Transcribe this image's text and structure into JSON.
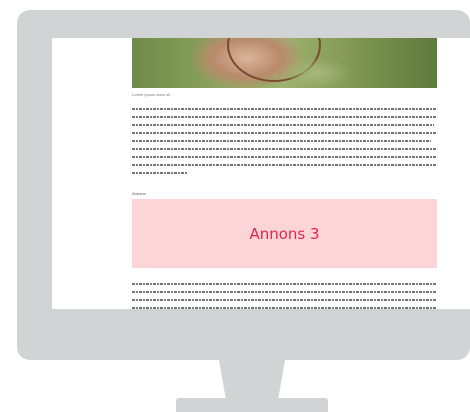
{
  "article": {
    "hero_image": "man-with-rope-in-grass-photo",
    "caption": "Lorem ipsum dolor sit",
    "ad_label": "Annons",
    "ad_text": "Annons 3"
  },
  "colors": {
    "monitor": "#d2d3d5",
    "ad_background": "#fdd5d8",
    "ad_text": "#e0264b"
  }
}
